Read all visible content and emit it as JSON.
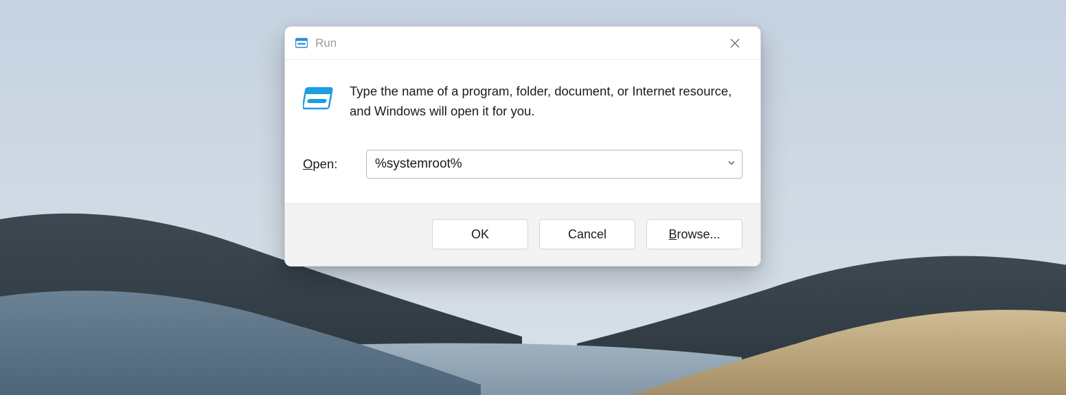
{
  "dialog": {
    "title": "Run",
    "description": "Type the name of a program, folder, document, or Internet resource, and Windows will open it for you.",
    "open_label_accesskey": "O",
    "open_label_rest": "pen:",
    "input_value": "%systemroot%",
    "buttons": {
      "ok": "OK",
      "cancel": "Cancel",
      "browse_accesskey": "B",
      "browse_rest": "rowse..."
    }
  }
}
